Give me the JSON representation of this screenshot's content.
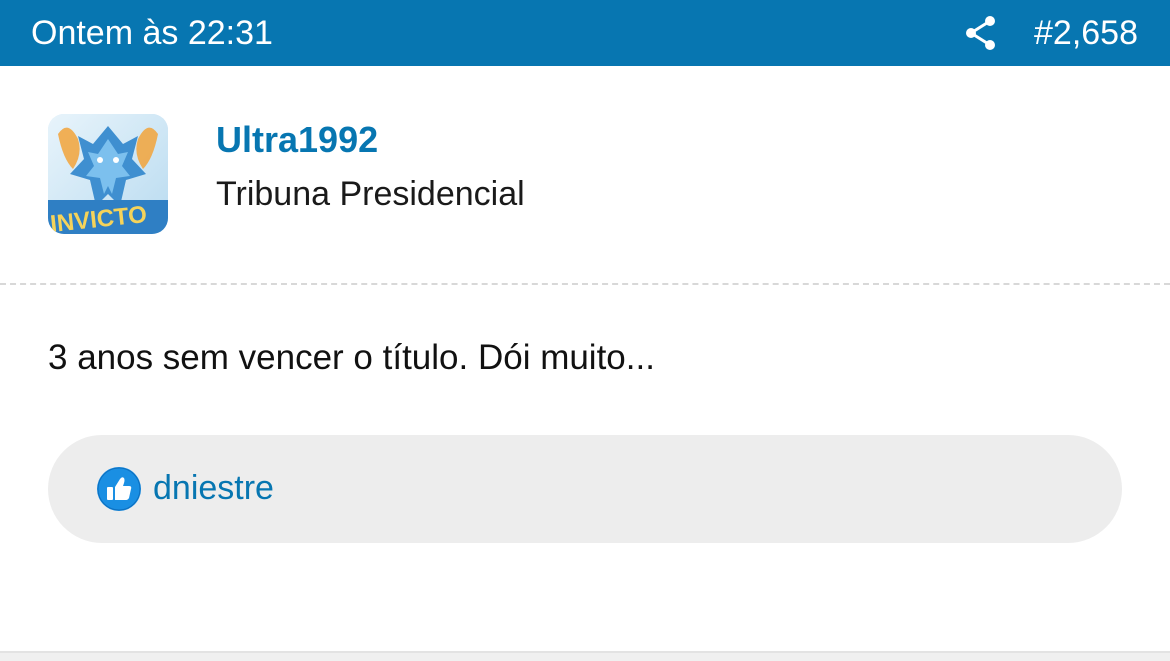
{
  "header": {
    "time": "Ontem às 22:31",
    "post_number": "#2,658",
    "share_icon": "share-icon",
    "background_color": "#0776b1"
  },
  "author": {
    "username": "Ultra1992",
    "title": "Tribuna Presidencial",
    "avatar_text": "INVICTO"
  },
  "message": {
    "text": "3 anos sem vencer o título. Dói muito..."
  },
  "reactions": {
    "icon": "thumbs-up-icon",
    "users": "dniestre"
  }
}
